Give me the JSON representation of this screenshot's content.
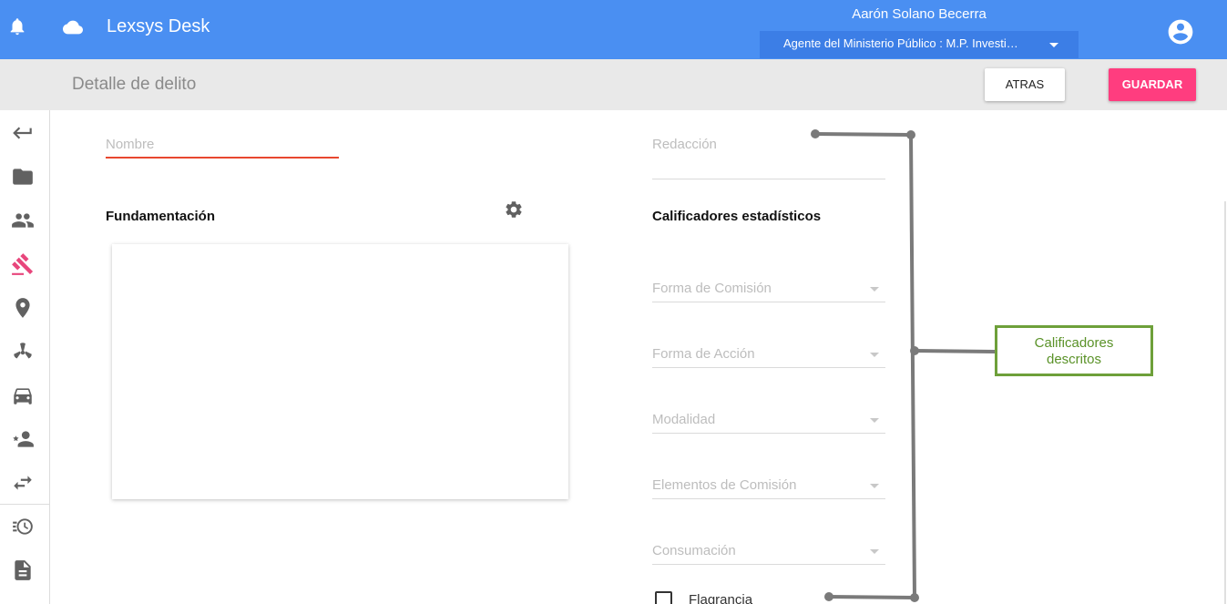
{
  "header": {
    "app_title": "Lexsys Desk",
    "user_name": "Aarón Solano Becerra",
    "role": "Agente del Ministerio Público : M.P. Investi…",
    "icons": [
      "bell-icon",
      "cloud-icon",
      "account-circle-icon",
      "arrow-drop-down-icon"
    ]
  },
  "toolbar": {
    "page_title": "Detalle de delito",
    "back_label": "ATRAS",
    "save_label": "GUARDAR"
  },
  "sidebar": {
    "items": [
      {
        "icon": "return-arrow-icon"
      },
      {
        "icon": "folder-icon"
      },
      {
        "icon": "people-icon"
      },
      {
        "icon": "gavel-icon",
        "active": true
      },
      {
        "icon": "location-pin-icon"
      },
      {
        "icon": "radioactive-icon"
      },
      {
        "icon": "car-icon"
      },
      {
        "icon": "person-star-icon"
      },
      {
        "icon": "swap-arrows-icon"
      },
      {
        "icon": "history-list-icon"
      },
      {
        "icon": "document-icon"
      }
    ]
  },
  "form": {
    "nombre_placeholder": "Nombre",
    "fundamentacion_title": "Fundamentación",
    "redaccion_placeholder": "Redacción",
    "calificadores_title": "Calificadores estadísticos",
    "dropdowns": [
      {
        "label": "Forma de Comisión"
      },
      {
        "label": "Forma de Acción"
      },
      {
        "label": "Modalidad"
      },
      {
        "label": "Elementos de Comisión"
      },
      {
        "label": "Consumación"
      }
    ],
    "flagrancia_label": "Flagrancia"
  },
  "annotation": {
    "callout_line1": "Calificadores",
    "callout_line2": "descritos"
  },
  "colors": {
    "header": "#4a8ff2",
    "role_select": "#3c7ee6",
    "save_button": "#ff3d7f",
    "active_icon": "#e8467c",
    "callout_border": "#6ea03a",
    "error_underline": "#e8472f"
  }
}
